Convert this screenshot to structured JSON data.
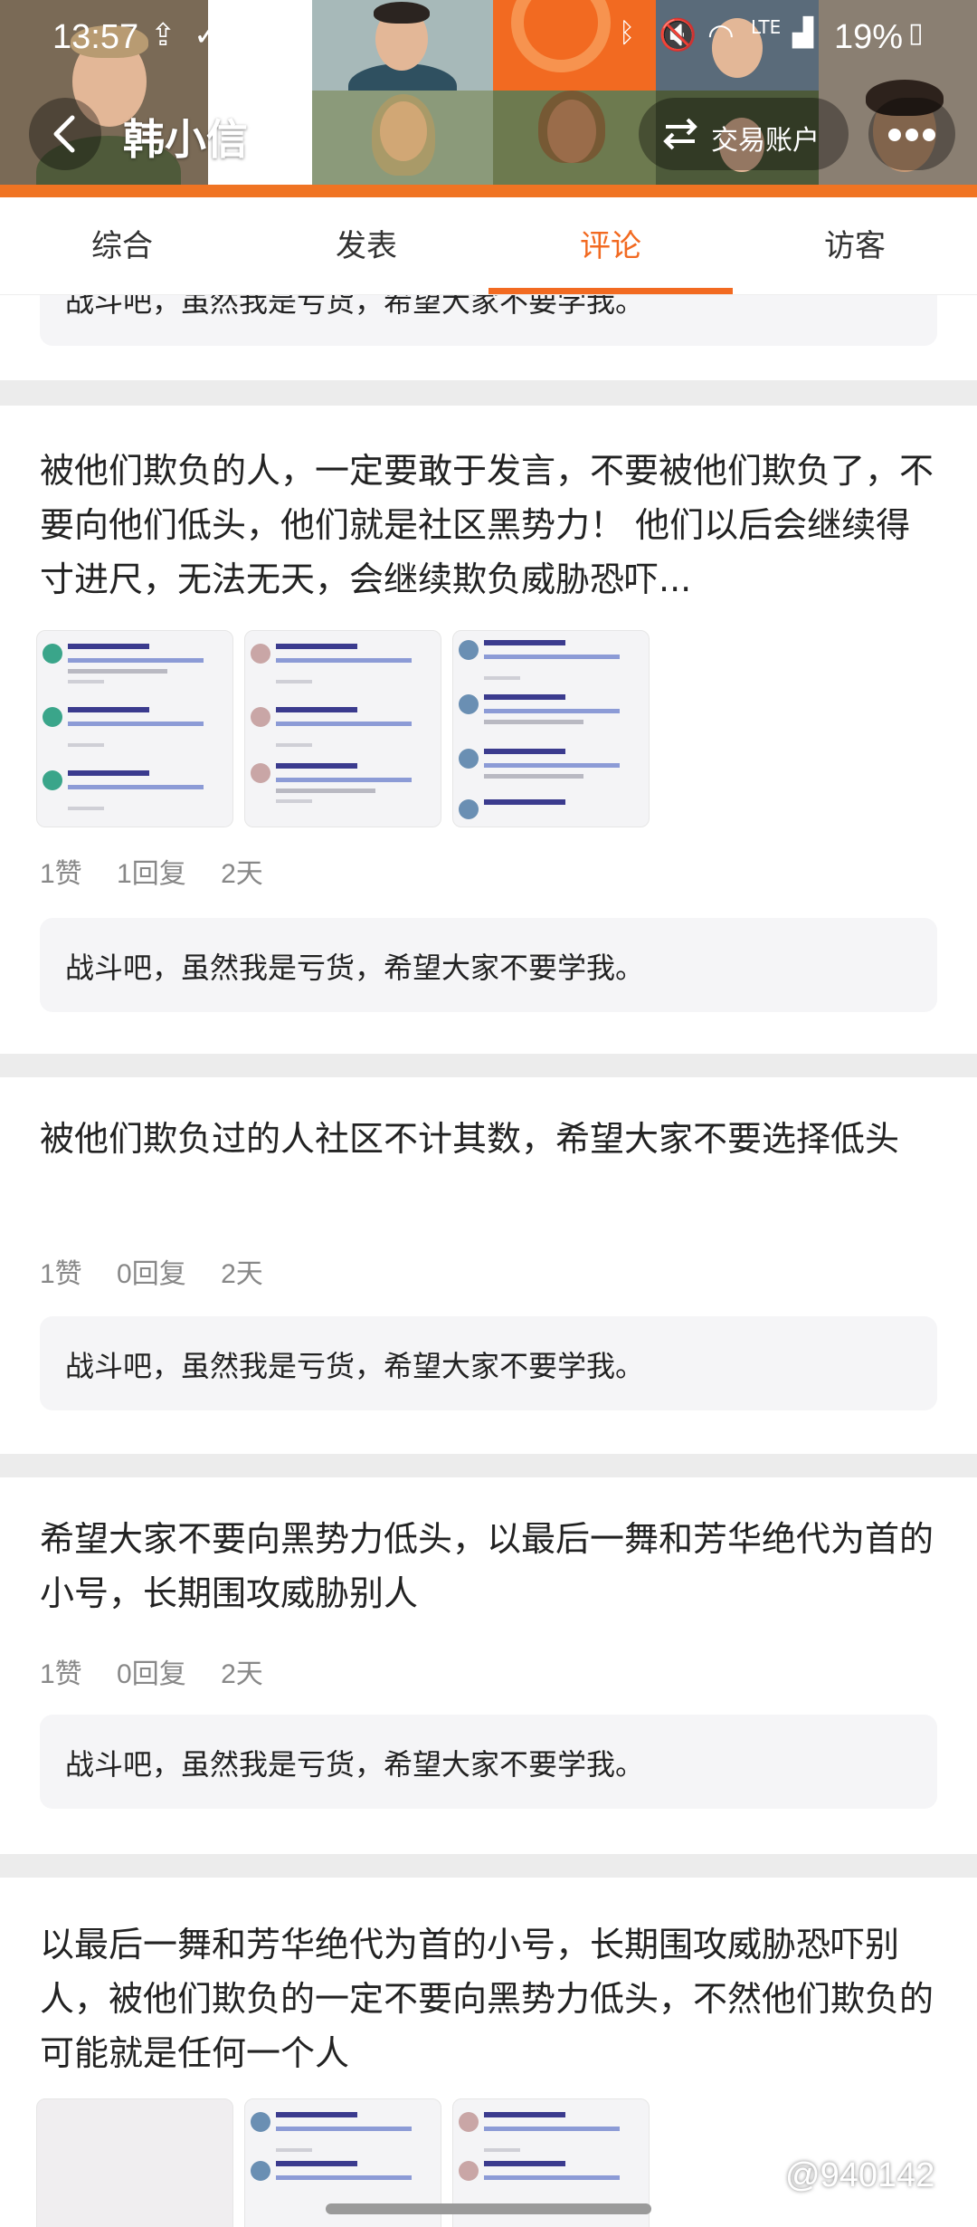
{
  "status_bar": {
    "time": "13:57",
    "network": "LTE",
    "battery": "19%"
  },
  "header": {
    "user_name": "韩小信",
    "trade_button": "交易账户",
    "back_icon": "chevron-left-icon",
    "more_icon": "more-dots-icon",
    "accent_color": "#f26a21"
  },
  "tabs": [
    {
      "label": "综合",
      "active": false
    },
    {
      "label": "发表",
      "active": false
    },
    {
      "label": "评论",
      "active": true
    },
    {
      "label": "访客",
      "active": false
    }
  ],
  "top_partial_reply": "战斗吧，虽然我是亏货，希望大家不要学我。",
  "posts": [
    {
      "text": "被他们欺负的人，一定要敢于发言，不要被他们欺负了，不要向他们低头，他们就是社区黑势力！ 他们以后会继续得寸进尺，无法无天，会继续欺负威胁恐吓...",
      "likes": "1赞",
      "replies": "1回复",
      "time": "2天",
      "reply": "战斗吧，虽然我是亏货，希望大家不要学我。"
    },
    {
      "text": "被他们欺负过的人社区不计其数，希望大家不要选择低头",
      "likes": "1赞",
      "replies": "0回复",
      "time": "2天",
      "reply": "战斗吧，虽然我是亏货，希望大家不要学我。"
    },
    {
      "text": "希望大家不要向黑势力低头，以最后一舞和芳华绝代为首的小号，长期围攻威胁别人",
      "likes": "1赞",
      "replies": "0回复",
      "time": "2天",
      "reply": "战斗吧，虽然我是亏货，希望大家不要学我。"
    },
    {
      "text": "以最后一舞和芳华绝代为首的小号，长期围攻威胁恐吓别人，被他们欺负的一定不要向黑势力低头，不然他们欺负的可能就是任何一个人"
    }
  ],
  "watermark": "@940142"
}
